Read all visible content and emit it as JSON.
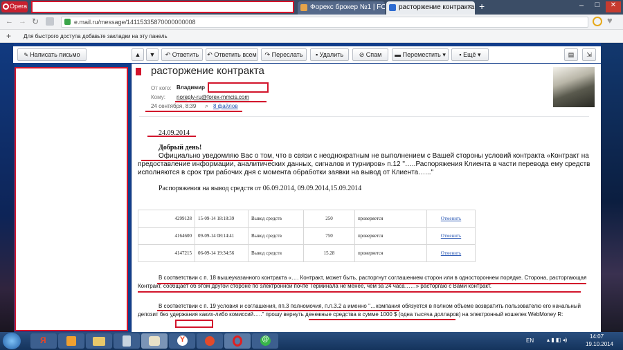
{
  "browser": {
    "app_name": "Opera",
    "tabs": [
      {
        "label": "Форекс брокер №1 | FOR"
      },
      {
        "label": "расторжение контракта"
      }
    ],
    "new_tab_symbol": "+",
    "window_minimize": "–",
    "window_maximize": "□",
    "window_close": "✕",
    "url": "e.mail.ru/message/14115335870000000008",
    "bookmarks_hint": "Для быстрого доступа добавьте закладки на эту панель"
  },
  "toolbar": {
    "compose": "Написать письмо",
    "reply": "Ответить",
    "reply_all": "Ответить всем",
    "forward": "Переслать",
    "delete": "Удалить",
    "spam": "Спам",
    "move": "Переместить",
    "more": "Ещё"
  },
  "message": {
    "subject": "расторжение контракта",
    "from_label": "От кого:",
    "from_name": "Владимир",
    "to_label": "Кому:",
    "to_address": "noreply-ru@forex-mmcis.com",
    "date": "24 сентября, 8:39",
    "attachments": "8 файлов",
    "body_date": "24.09.2014",
    "greeting": "Добрый день!",
    "para1": "Официально уведомляю Вас о том, что в связи с неоднократным не выполнением с Вашей стороны условий контракта «Контракт на предоставление информации, аналитических данных, сигналов и турниров» п.12 \"…..Распоряжения Клиента в части перевода ему средств исполняются в срок три рабочих дня с момента обработки заявки на вывод от Клиента…...\"",
    "orders_title": "Распоряжения на вывод средств от 06.09.2014, 09.09.2014,15.09.2014",
    "orders": [
      {
        "id": "4299128",
        "datetime": "15-09-14 18:18:39",
        "type": "Вывод средств",
        "amount": "250",
        "status": "проверяется",
        "action": "Отменить"
      },
      {
        "id": "4164600",
        "datetime": "09-09-14 08:14:41",
        "type": "Вывод средств",
        "amount": "750",
        "status": "проверяется",
        "action": "Отменить"
      },
      {
        "id": "4147215",
        "datetime": "06-09-14 19:34:56",
        "type": "Вывод средств",
        "amount": "15.28",
        "status": "проверяется",
        "action": "Отменить"
      }
    ],
    "para2": "В соответствии с п. 18 вышеуказанного контракта «…. Контракт, может быть, расторгнут соглашением сторон или в одностороннем порядке. Сторона, расторгающая Контракт, сообщает об этом другой стороне по электронной почте Терминала не менее, чем за 24 часа……» расторгаю с Вами контракт.",
    "para3": "В соответствии с п. 19 условия и соглашения, пп.3 полномочия, п.п.3.2 а именно \"…компания обязуется в полном объеме возвратить пользователю его начальный депозит без удержания каких-либо комиссий…..\" прошу вернуть денежные средства в сумме 1000 $ (одна тысяча долларов) на электронный кошелек WebMoney R:"
  },
  "taskbar": {
    "lang": "EN",
    "time": "14:07",
    "date": "19.10.2014"
  },
  "colors": {
    "annotation": "#d2142b",
    "mail_header": "#123d8a",
    "browser_tabs": "#3b4d66"
  }
}
